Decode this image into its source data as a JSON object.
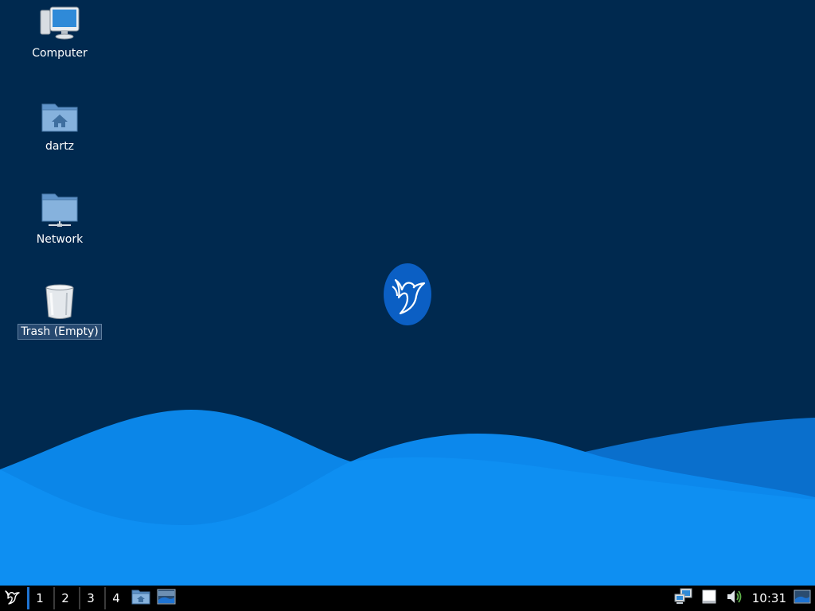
{
  "desktop": {
    "background_color": "#00294f",
    "wave_colors": [
      "#0a7de0",
      "#0b8cf0",
      "#1a98f5"
    ],
    "icons": [
      {
        "label": "Computer",
        "icon": "computer-icon"
      },
      {
        "label": "dartz",
        "icon": "home-folder-icon"
      },
      {
        "label": "Network",
        "icon": "network-folder-icon"
      },
      {
        "label": "Trash (Empty)",
        "icon": "trash-icon"
      }
    ],
    "center_logo": "hummingbird-logo-icon"
  },
  "taskbar": {
    "menu_icon": "start-menu-hummingbird-icon",
    "workspaces": [
      "1",
      "2",
      "3",
      "4"
    ],
    "active_workspace": "1",
    "launchers": [
      "file-manager-icon",
      "show-desktop-icon"
    ],
    "tray": [
      "network-icon",
      "clipboard-icon",
      "volume-icon"
    ],
    "clock": "10:31",
    "end_icon": "desktop-switch-icon",
    "accent_color": "#1e73d2"
  }
}
